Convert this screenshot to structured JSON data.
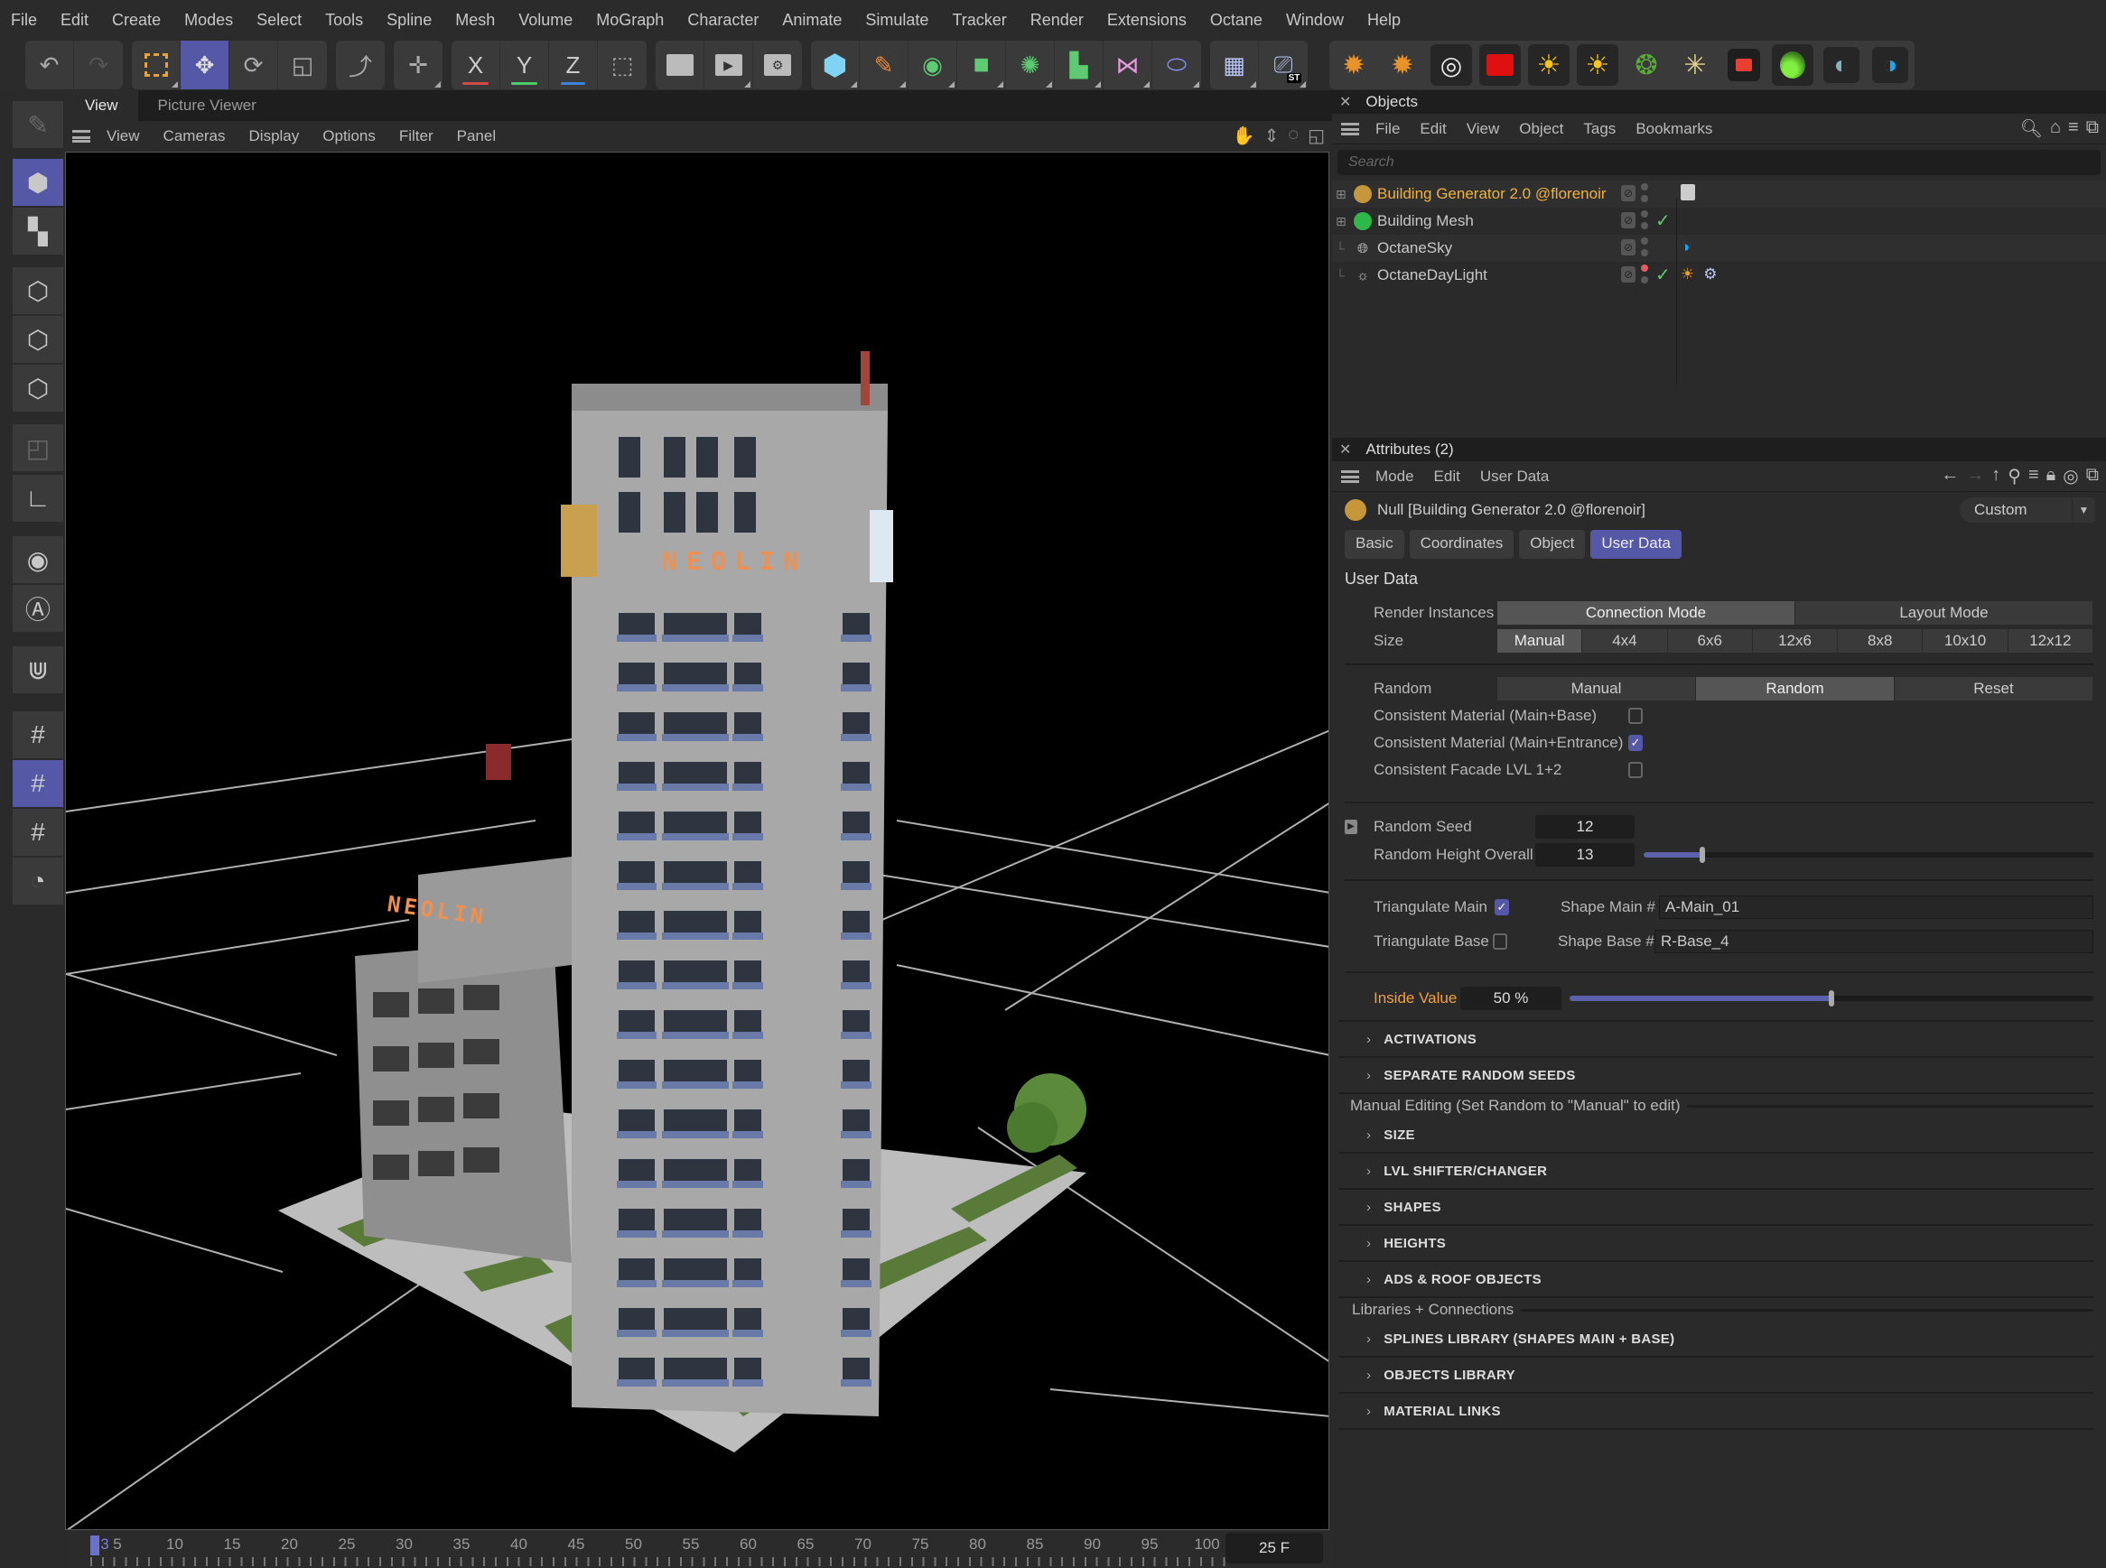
{
  "menubar": [
    "File",
    "Edit",
    "Create",
    "Modes",
    "Select",
    "Tools",
    "Spline",
    "Mesh",
    "Volume",
    "MoGraph",
    "Character",
    "Animate",
    "Simulate",
    "Tracker",
    "Render",
    "Extensions",
    "Octane",
    "Window",
    "Help"
  ],
  "toolbar": {
    "axis_labels": {
      "x": "X",
      "y": "Y",
      "z": "Z"
    },
    "octane_badge": "ST"
  },
  "viewport": {
    "tabs": [
      {
        "label": "View",
        "active": true
      },
      {
        "label": "Picture Viewer",
        "active": false
      }
    ],
    "menu": [
      "View",
      "Cameras",
      "Display",
      "Options",
      "Filter",
      "Panel"
    ],
    "sign_text": "NEOLIN"
  },
  "timeline": {
    "current_frame_marker": "3",
    "labels": [
      "5",
      "10",
      "15",
      "20",
      "25",
      "30",
      "35",
      "40",
      "45",
      "50",
      "55",
      "60",
      "65",
      "70",
      "75",
      "80",
      "85",
      "90",
      "95",
      "100"
    ],
    "frame_readout": "25 F"
  },
  "objects_panel": {
    "title": "Objects",
    "menu": [
      "File",
      "Edit",
      "View",
      "Object",
      "Tags",
      "Bookmarks"
    ],
    "search_placeholder": "Search",
    "items": [
      {
        "name": "Building Generator 2.0 @florenoir",
        "selected": true,
        "color": "#c6973a",
        "checked": false
      },
      {
        "name": "Building Mesh",
        "selected": false,
        "color": "#2eb84a",
        "checked": true
      },
      {
        "name": "OctaneSky",
        "selected": false,
        "color": "",
        "checked": false
      },
      {
        "name": "OctaneDayLight",
        "selected": false,
        "color": "",
        "checked": true
      }
    ]
  },
  "attributes_panel": {
    "title": "Attributes (2)",
    "menu": [
      "Mode",
      "Edit",
      "User Data"
    ],
    "object_label": "Null [Building Generator 2.0 @florenoir]",
    "preset": "Custom",
    "tabs": [
      {
        "label": "Basic",
        "active": false
      },
      {
        "label": "Coordinates",
        "active": false
      },
      {
        "label": "Object",
        "active": false
      },
      {
        "label": "User Data",
        "active": true
      }
    ],
    "section_title": "User Data",
    "render_instances": {
      "label": "Render Instances",
      "options": [
        "Connection Mode",
        "Layout Mode"
      ],
      "selected": "Connection Mode"
    },
    "size": {
      "label": "Size",
      "options": [
        "Manual",
        "4x4",
        "6x6",
        "12x6",
        "8x8",
        "10x10",
        "12x12"
      ],
      "selected": "Manual"
    },
    "random": {
      "label": "Random",
      "options": [
        "Manual",
        "Random",
        "Reset"
      ],
      "selected": "Random"
    },
    "checkboxes": [
      {
        "label": "Consistent Material (Main+Base)",
        "checked": false
      },
      {
        "label": "Consistent Material (Main+Entrance)",
        "checked": true
      },
      {
        "label": "Consistent Facade LVL 1+2",
        "checked": false
      }
    ],
    "random_seed": {
      "label": "Random Seed",
      "value": "12"
    },
    "random_height": {
      "label": "Random Height Overall",
      "value": "13",
      "slider_fraction": 0.13
    },
    "triangulate_main": {
      "label": "Triangulate Main",
      "checked": true
    },
    "triangulate_base": {
      "label": "Triangulate Base",
      "checked": false
    },
    "shape_main": {
      "label": "Shape Main #",
      "value": "A-Main_01"
    },
    "shape_base": {
      "label": "Shape Base #",
      "value": "R-Base_4"
    },
    "inside_value": {
      "label": "Inside Value",
      "value": "50 %",
      "slider_fraction": 0.5,
      "label_color": "#f0a040"
    },
    "groups_1": [
      "ACTIVATIONS",
      "SEPARATE RANDOM SEEDS"
    ],
    "manual_editing_header": "Manual Editing (Set Random to \"Manual\" to edit)",
    "groups_2": [
      "SIZE",
      "LVL SHIFTER/CHANGER",
      "SHAPES",
      "HEIGHTS",
      "ADS & ROOF OBJECTS"
    ],
    "libraries_header": "Libraries + Connections",
    "groups_3": [
      "SPLINES LIBRARY (SHAPES MAIN + BASE)",
      "OBJECTS LIBRARY",
      "MATERIAL LINKS"
    ]
  },
  "colors": {
    "accent": "#5558a6",
    "selected_object": "#f0b23a",
    "check": "#5ecb72"
  }
}
